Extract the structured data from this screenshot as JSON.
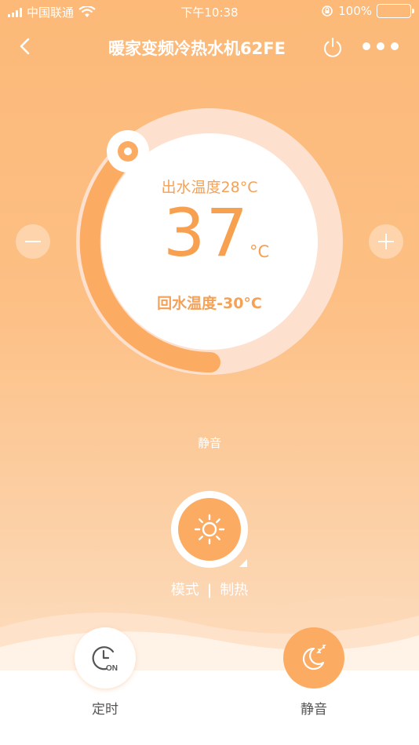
{
  "status_bar": {
    "carrier": "中国联通",
    "time": "下午10:38",
    "battery": "100%",
    "icons": [
      "signal-icon",
      "wifi-icon",
      "orientation-lock-icon",
      "battery-icon"
    ]
  },
  "nav": {
    "title": "暖家变频冷热水机62FE",
    "icons": [
      "back-icon",
      "power-icon",
      "more-icon"
    ]
  },
  "dial": {
    "setpoint_label": "出水温度28°C",
    "temperature": "37",
    "unit": "°C",
    "return_label": "回水温度-30°C",
    "minus_icon": "minus-icon",
    "plus_icon": "plus-icon"
  },
  "status_text": "静音",
  "mode": {
    "label": "模式",
    "separator": "|",
    "value": "制热",
    "icon": "sun-icon"
  },
  "actions": {
    "timer_label": "定时",
    "timer_icon_text": "ON",
    "mute_label": "静音",
    "icons": [
      "timer-clock-icon",
      "moon-sleep-icon"
    ]
  },
  "colors": {
    "accent": "#fcab62",
    "text_accent": "#f7a050"
  }
}
